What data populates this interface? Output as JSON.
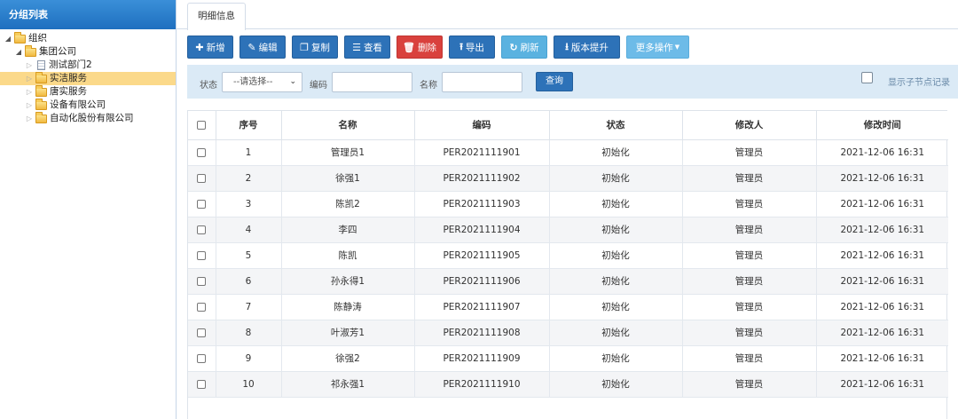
{
  "sidebar": {
    "title": "分组列表",
    "tree": {
      "root": "组织",
      "company": "集团公司",
      "dept_test": "测试部门2",
      "dept_practice": "实洁服务",
      "dept_tangshi": "唐实服务",
      "dept_equip": "设备有限公司",
      "dept_auto": "自动化股份有限公司"
    }
  },
  "tab": {
    "label": "明细信息"
  },
  "toolbar": {
    "add": "新增",
    "edit": "编辑",
    "copy": "复制",
    "view": "查看",
    "delete": "删除",
    "export": "导出",
    "refresh": "刷新",
    "upgrade": "版本提升",
    "more": "更多操作"
  },
  "filter": {
    "status_label": "状态",
    "status_value": "--请选择--",
    "code_label": "编码",
    "name_label": "名称",
    "query": "查询",
    "show_children": "显示子节点记录"
  },
  "table": {
    "headers": [
      "序号",
      "名称",
      "编码",
      "状态",
      "修改人",
      "修改时间"
    ],
    "rows": [
      [
        "1",
        "管理员1",
        "PER2021111901",
        "初始化",
        "管理员",
        "2021-12-06 16:31"
      ],
      [
        "2",
        "徐强1",
        "PER2021111902",
        "初始化",
        "管理员",
        "2021-12-06 16:31"
      ],
      [
        "3",
        "陈凯2",
        "PER2021111903",
        "初始化",
        "管理员",
        "2021-12-06 16:31"
      ],
      [
        "4",
        "李四",
        "PER2021111904",
        "初始化",
        "管理员",
        "2021-12-06 16:31"
      ],
      [
        "5",
        "陈凯",
        "PER2021111905",
        "初始化",
        "管理员",
        "2021-12-06 16:31"
      ],
      [
        "6",
        "孙永得1",
        "PER2021111906",
        "初始化",
        "管理员",
        "2021-12-06 16:31"
      ],
      [
        "7",
        "陈静涛",
        "PER2021111907",
        "初始化",
        "管理员",
        "2021-12-06 16:31"
      ],
      [
        "8",
        "叶淑芳1",
        "PER2021111908",
        "初始化",
        "管理员",
        "2021-12-06 16:31"
      ],
      [
        "9",
        "徐强2",
        "PER2021111909",
        "初始化",
        "管理员",
        "2021-12-06 16:31"
      ],
      [
        "10",
        "祁永强1",
        "PER2021111910",
        "初始化",
        "管理员",
        "2021-12-06 16:31"
      ]
    ]
  },
  "colors": {
    "primary": "#2d72b8",
    "danger": "#d9413d",
    "selected_node": "#fbd98a",
    "filter_bg": "#dbeaf6"
  }
}
